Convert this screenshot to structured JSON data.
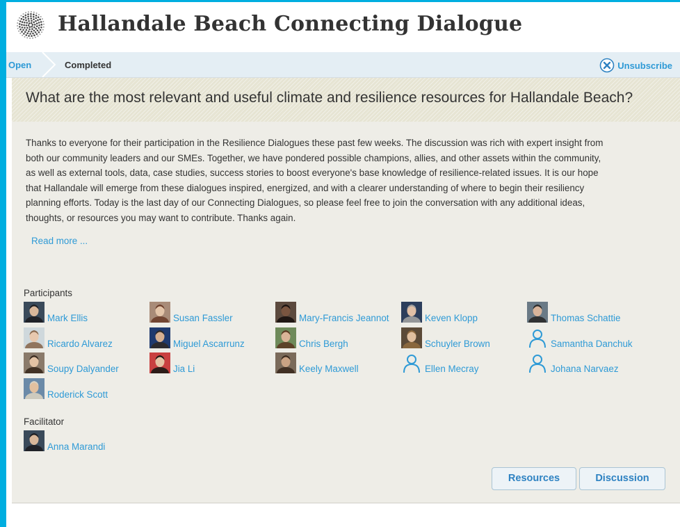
{
  "header": {
    "title": "Hallandale Beach Connecting Dialogue",
    "logo_icon": "dotted-sphere-logo"
  },
  "breadcrumb": {
    "open_label": "Open",
    "completed_label": "Completed"
  },
  "unsubscribe": {
    "label": "Unsubscribe",
    "icon": "close-circle-icon"
  },
  "question": "What are the most relevant and useful climate and resilience resources for Hallandale Beach?",
  "description": {
    "lines": [
      "Thanks to everyone for their participation in the Resilience Dialogues these past few weeks. The discussion was rich with expert insight from",
      "both our community leaders and our SMEs. Together, we have pondered possible champions, allies, and other assets within the community,",
      "as well as external tools, data, case studies, success stories to boost everyone's base knowledge of resilience-related issues. It is our hope",
      "that Hallandale will emerge from these dialogues inspired, energized, and with a clearer understanding of where to begin their resiliency",
      "planning efforts. Today is the last day of our Connecting Dialogues, so please feel free to join the conversation with any additional ideas,",
      "thoughts, or resources you may want to contribute. Thanks again."
    ],
    "read_more": "Read more ..."
  },
  "participants": {
    "label": "Participants",
    "people": [
      {
        "name": "Mark Ellis",
        "avatar": "photo"
      },
      {
        "name": "Susan Fassler",
        "avatar": "photo"
      },
      {
        "name": "Mary-Francis Jeannot",
        "avatar": "photo"
      },
      {
        "name": "Keven Klopp",
        "avatar": "photo"
      },
      {
        "name": "Thomas Schattie",
        "avatar": "photo"
      },
      {
        "name": "Ricardo Alvarez",
        "avatar": "photo"
      },
      {
        "name": "Miguel Ascarrunz",
        "avatar": "photo"
      },
      {
        "name": "Chris Bergh",
        "avatar": "photo"
      },
      {
        "name": "Schuyler Brown",
        "avatar": "photo"
      },
      {
        "name": "Samantha Danchuk",
        "avatar": "default-user-icon"
      },
      {
        "name": "Soupy Dalyander",
        "avatar": "photo"
      },
      {
        "name": "Jia Li",
        "avatar": "photo"
      },
      {
        "name": "Keely Maxwell",
        "avatar": "photo"
      },
      {
        "name": "Ellen Mecray",
        "avatar": "default-user-icon"
      },
      {
        "name": "Johana Narvaez",
        "avatar": "default-user-icon"
      },
      {
        "name": "Roderick Scott",
        "avatar": "photo"
      }
    ]
  },
  "facilitator": {
    "label": "Facilitator",
    "people": [
      {
        "name": "Anna Marandi",
        "avatar": "photo"
      }
    ]
  },
  "actions": {
    "resources_label": "Resources",
    "discussion_label": "Discussion"
  },
  "colors": {
    "frame": "#00aee0",
    "link": "#2e9ad6",
    "text": "#333333",
    "panel_bg": "#eeede7",
    "banner_bg": "#e6e4d3",
    "breadcrumb_bg": "#e4eef4"
  }
}
